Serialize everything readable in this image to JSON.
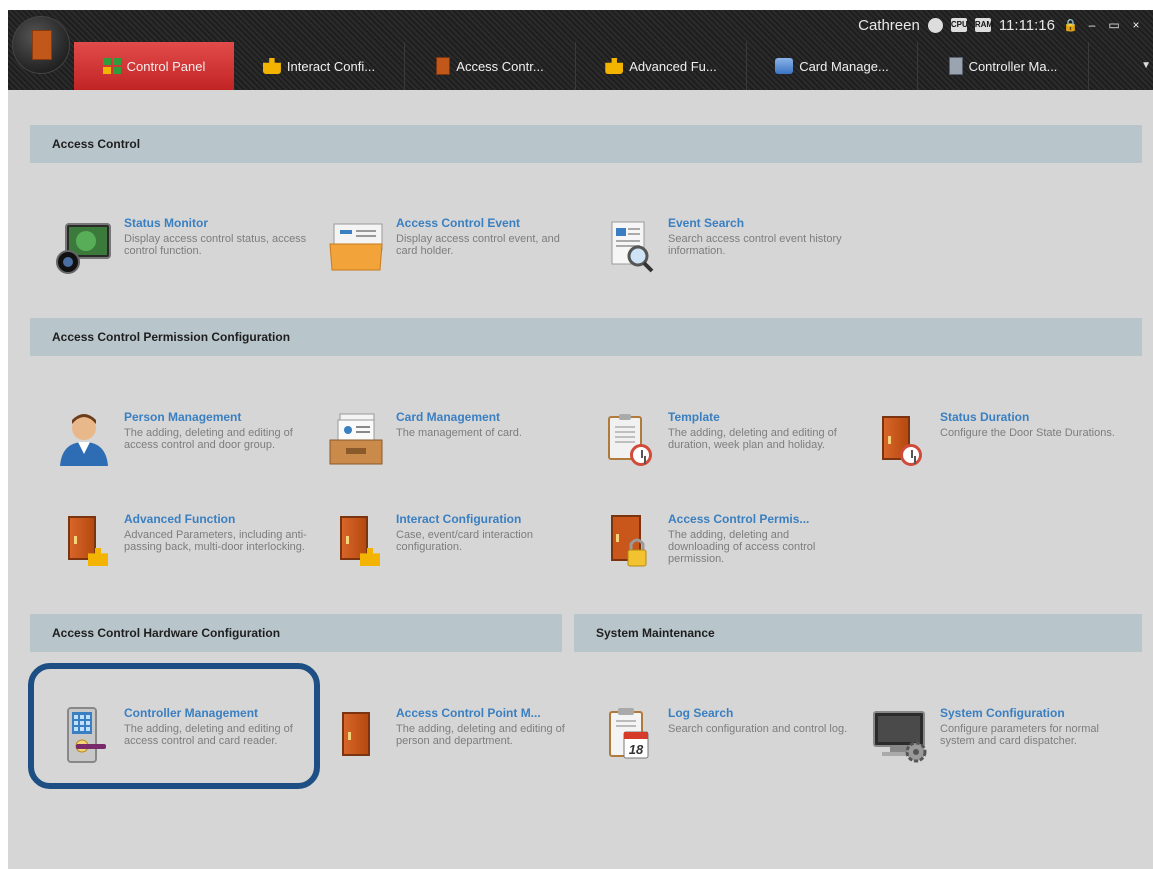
{
  "window": {
    "user": "Cathreen",
    "time": "11:11:16",
    "ram_label": "RAM",
    "cpu_label": "CPU",
    "controls": {
      "lock": "🔒",
      "minimize": "–",
      "maximize": "▭",
      "close": "×"
    }
  },
  "tabs": [
    {
      "label": "Control Panel",
      "icon": "grid-icon",
      "active": true
    },
    {
      "label": "Interact Confi...",
      "icon": "puzzle-icon"
    },
    {
      "label": "Access Contr...",
      "icon": "door-lock-icon"
    },
    {
      "label": "Advanced Fu...",
      "icon": "puzzle-icon"
    },
    {
      "label": "Card Manage...",
      "icon": "card-icon"
    },
    {
      "label": "Controller Ma...",
      "icon": "controller-icon"
    }
  ],
  "sections": {
    "access_control": {
      "title": "Access Control",
      "items": [
        {
          "title": "Status Monitor",
          "desc": "Display access control status, access control function.",
          "icon": "monitor-camera-icon"
        },
        {
          "title": "Access Control Event",
          "desc": "Display access control event, and card holder.",
          "icon": "folder-card-icon"
        },
        {
          "title": "Event Search",
          "desc": "Search access control event history information.",
          "icon": "document-search-icon"
        }
      ]
    },
    "permission": {
      "title": "Access Control Permission Configuration",
      "items": [
        {
          "title": "Person Management",
          "desc": "The adding, deleting and editing of access control and door group.",
          "icon": "person-icon"
        },
        {
          "title": "Card Management",
          "desc": "The management of card.",
          "icon": "card-tray-icon"
        },
        {
          "title": "Template",
          "desc": "The adding, deleting and editing of duration, week plan and holiday.",
          "icon": "clipboard-clock-icon"
        },
        {
          "title": "Status Duration",
          "desc": "Configure the Door State Durations.",
          "icon": "door-clock-icon"
        },
        {
          "title": "Advanced Function",
          "desc": "Advanced Parameters, including anti-passing back, multi-door interlocking.",
          "icon": "door-puzzle-icon"
        },
        {
          "title": "Interact Configuration",
          "desc": "Case, event/card interaction configuration.",
          "icon": "door-puzzle-icon"
        },
        {
          "title": "Access Control Permis...",
          "desc": "The adding, deleting and downloading of access control permission.",
          "icon": "door-lock-icon"
        }
      ]
    },
    "hardware": {
      "title": "Access Control Hardware Configuration",
      "items": [
        {
          "title": "Controller Management",
          "desc": "The adding, deleting and editing of access control and card reader.",
          "icon": "controller-device-icon"
        },
        {
          "title": "Access Control Point M...",
          "desc": "The adding, deleting and editing of person and department.",
          "icon": "door-icon"
        }
      ]
    },
    "maintenance": {
      "title": "System Maintenance",
      "items": [
        {
          "title": "Log Search",
          "desc": "Search configuration and control log.",
          "icon": "calendar-log-icon",
          "calendar_day": "18"
        },
        {
          "title": "System Configuration",
          "desc": "Configure parameters for normal system and card dispatcher.",
          "icon": "monitor-gear-icon"
        }
      ]
    }
  }
}
